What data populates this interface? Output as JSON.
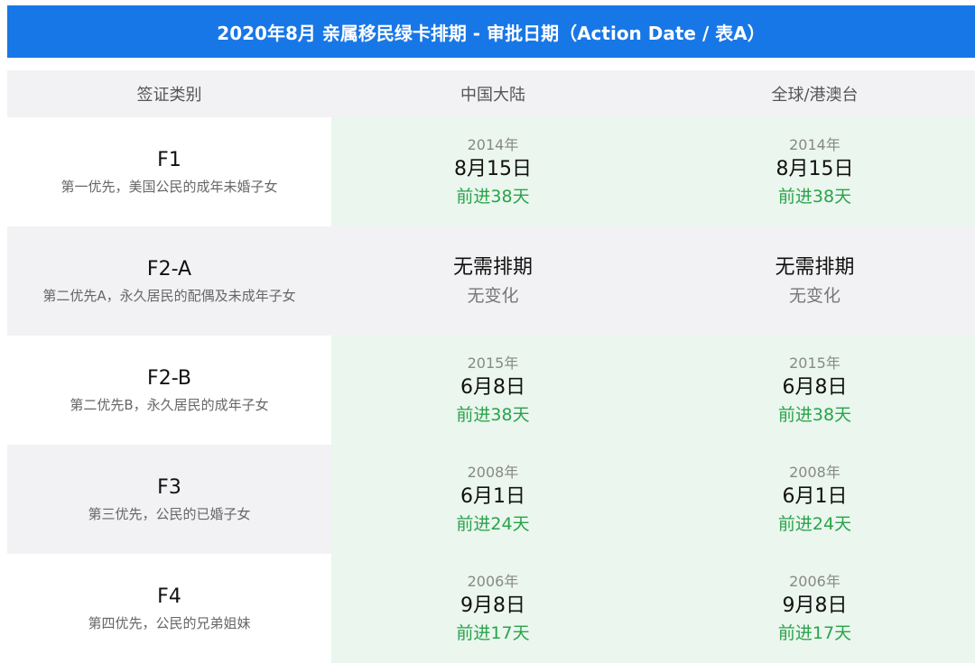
{
  "title": "2020年8月 亲属移民绿卡排期 - 审批日期（Action Date / 表A）",
  "columns": [
    "签证类别",
    "中国大陆",
    "全球/港澳台"
  ],
  "rows": [
    {
      "code": "F1",
      "desc": "第一优先，美国公民的成年未婚子女",
      "china": {
        "year": "2014年",
        "date": "8月15日",
        "change": "前进38天"
      },
      "world": {
        "year": "2014年",
        "date": "8月15日",
        "change": "前进38天"
      }
    },
    {
      "code": "F2-A",
      "desc": "第二优先A，永久居民的配偶及未成年子女",
      "china": {
        "main": "无需排期",
        "change": "无变化"
      },
      "world": {
        "main": "无需排期",
        "change": "无变化"
      }
    },
    {
      "code": "F2-B",
      "desc": "第二优先B，永久居民的成年子女",
      "china": {
        "year": "2015年",
        "date": "6月8日",
        "change": "前进38天"
      },
      "world": {
        "year": "2015年",
        "date": "6月8日",
        "change": "前进38天"
      }
    },
    {
      "code": "F3",
      "desc": "第三优先，公民的已婚子女",
      "china": {
        "year": "2008年",
        "date": "6月1日",
        "change": "前进24天"
      },
      "world": {
        "year": "2008年",
        "date": "6月1日",
        "change": "前进24天"
      }
    },
    {
      "code": "F4",
      "desc": "第四优先，公民的兄弟姐妹",
      "china": {
        "year": "2006年",
        "date": "9月8日",
        "change": "前进17天"
      },
      "world": {
        "year": "2006年",
        "date": "9月8日",
        "change": "前进17天"
      }
    }
  ],
  "colors": {
    "header": "#1877e6",
    "advance": "#2aa34a",
    "green_cell": "#eaf6ee",
    "gray_cell": "#f2f2f4"
  }
}
